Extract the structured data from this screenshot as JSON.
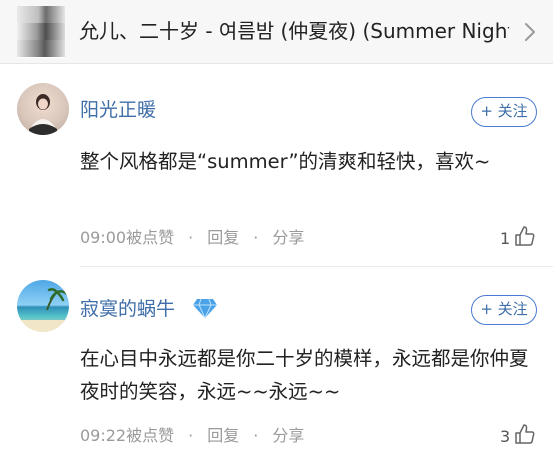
{
  "song": {
    "title": "允儿、二十岁 - 여름밤 (仲夏夜) (Summer Night)",
    "cover_icon": "album-cover",
    "open_icon": "chevron-right-icon"
  },
  "comments": [
    {
      "username": "阳光正暖",
      "follow_label": "+ 关注",
      "text": "整个风格都是“summer”的清爽和轻快，喜欢~",
      "time_action": "09:00被点赞",
      "reply_label": "回复",
      "share_label": "分享",
      "likes": "1"
    },
    {
      "username": "寂寞的蜗牛",
      "follow_label": "+ 关注",
      "badge_icon": "diamond-badge-icon",
      "text": "在心目中永远都是你二十岁的模样，永远都是你仲夏夜时的笑容，永远~~永远~~",
      "time_action": "09:22被点赞",
      "reply_label": "回复",
      "share_label": "分享",
      "likes": "3"
    }
  ],
  "colors": {
    "username": "#3f6ea8",
    "follow_border": "#4a7bd0",
    "meta": "#9a9a9a",
    "badge": "#4aa3e8"
  }
}
